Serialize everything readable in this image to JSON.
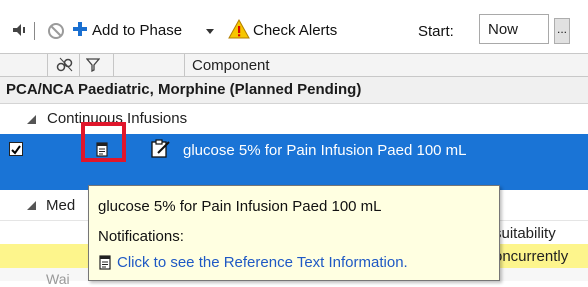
{
  "toolbar": {
    "add_to_phase_label": "Add to Phase",
    "check_alerts_label": "Check Alerts",
    "start_label": "Start:",
    "start_value": "Now",
    "ellipsis_label": "..."
  },
  "grid": {
    "column_component": "Component"
  },
  "phase": {
    "title": "PCA/NCA Paediatric, Morphine (Planned Pending)"
  },
  "sections": {
    "continuous_infusions": "Continuous Infusions",
    "medications_partial": "Med",
    "wai_partial": "Wai"
  },
  "selected_row": {
    "component": "glucose 5% for Pain Infusion Paed 100 mL",
    "checked": true
  },
  "rows": {
    "suitability_partial": "suitability",
    "concurrently_partial": "oncurrently"
  },
  "tooltip": {
    "title": "glucose 5% for Pain Infusion Paed 100 mL",
    "notifications_label": "Notifications:",
    "link_text": "Click to see the Reference Text Information."
  },
  "colors": {
    "selection": "#1a74d6",
    "tooltip_bg": "#ffffe1",
    "highlight": "#e0162b",
    "warning_row": "#fdf58c",
    "link": "#1f59c4"
  }
}
